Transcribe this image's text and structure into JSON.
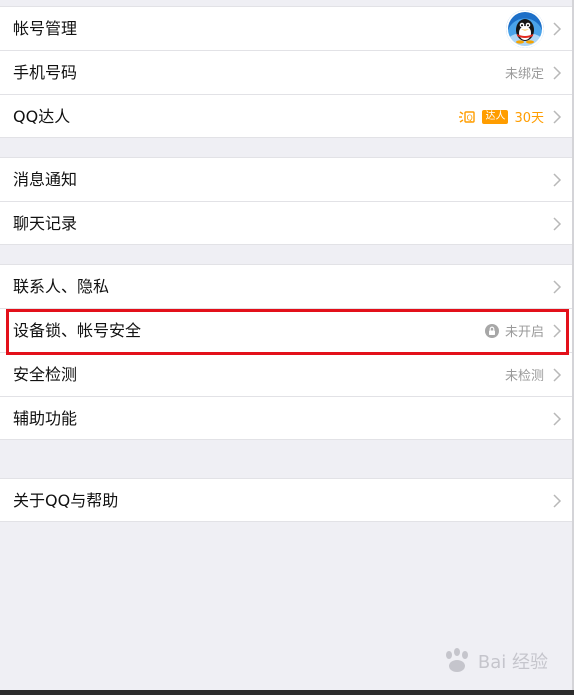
{
  "groups": [
    {
      "rows": [
        {
          "label": "帐号管理",
          "right": ""
        },
        {
          "label": "手机号码",
          "right": "未绑定"
        },
        {
          "label": "QQ达人",
          "right": "30天"
        }
      ]
    },
    {
      "rows": [
        {
          "label": "消息通知",
          "right": ""
        },
        {
          "label": "聊天记录",
          "right": ""
        }
      ]
    },
    {
      "rows": [
        {
          "label": "联系人、隐私",
          "right": ""
        },
        {
          "label": "设备锁、帐号安全",
          "right": "未开启"
        },
        {
          "label": "安全检测",
          "right": "未检测"
        },
        {
          "label": "辅助功能",
          "right": ""
        }
      ]
    },
    {
      "rows": [
        {
          "label": "关于QQ与帮助",
          "right": ""
        }
      ]
    }
  ],
  "vip_badge_label": "达人",
  "watermark": "Bai 经验",
  "colors": {
    "highlight": "#e3101a",
    "vip": "#ff9d00",
    "background": "#efeff4"
  }
}
